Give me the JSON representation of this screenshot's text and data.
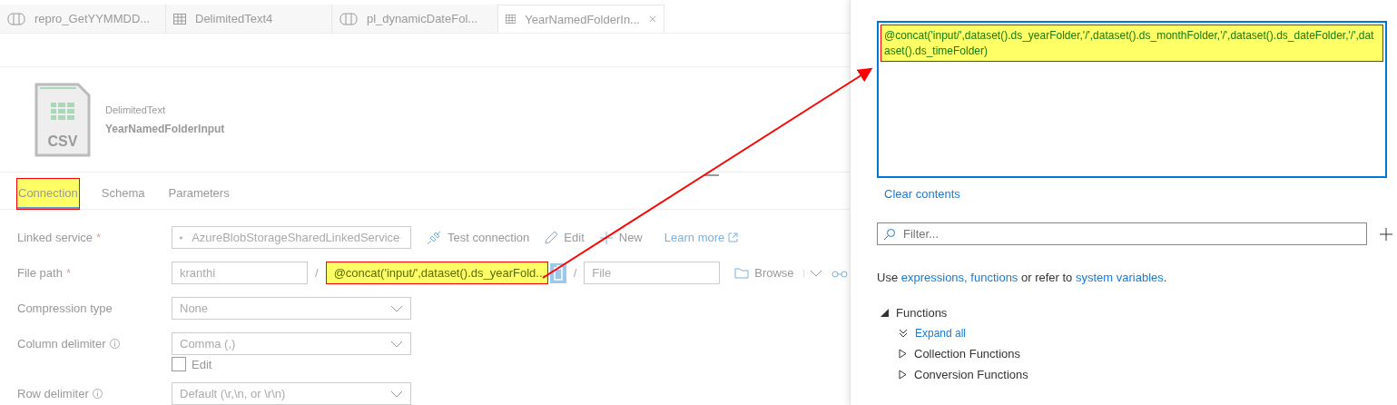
{
  "doc_tabs": [
    {
      "label": "repro_GetYYMMDD...",
      "kind": "pipeline",
      "selected": false
    },
    {
      "label": "DelimitedText4",
      "kind": "dataset",
      "selected": false
    },
    {
      "label": "pl_dynamicDateFol...",
      "kind": "pipeline",
      "selected": false
    },
    {
      "label": "YearNamedFolderIn...",
      "kind": "dataset",
      "selected": true
    }
  ],
  "dataset": {
    "type": "DelimitedText",
    "name": "YearNamedFolderInput",
    "icon_label": "CSV"
  },
  "section_tabs": [
    {
      "label": "Connection",
      "selected": true,
      "highlighted": true
    },
    {
      "label": "Schema",
      "selected": false,
      "highlighted": false
    },
    {
      "label": "Parameters",
      "selected": false,
      "highlighted": false
    }
  ],
  "linked_service": {
    "label": "Linked service",
    "required_mark": "*",
    "value": "AzureBlobStorageSharedLinkedService",
    "actions": [
      {
        "label": "Test connection",
        "kind": "plug"
      },
      {
        "label": "Edit",
        "kind": "pencil"
      },
      {
        "label": "New",
        "kind": "plus"
      },
      {
        "label": "Learn more",
        "kind": "link"
      }
    ]
  },
  "file_path": {
    "label": "File path",
    "required_mark": "*",
    "container": "kranthi",
    "separators": [
      "/",
      "/"
    ],
    "directory": "@concat('input/',dataset().ds_yearFold...",
    "directory_highlighted": true,
    "file_placeholder": "File",
    "browse": "Browse"
  },
  "compression": {
    "label": "Compression type",
    "value": "None"
  },
  "column_delimiter": {
    "label": "Column delimiter",
    "info": true,
    "value": "Comma (,)",
    "edit_label": "Edit",
    "edit_checked": false
  },
  "row_delimiter": {
    "label": "Row delimiter",
    "info": true,
    "value": "Default (\\r,\\n, or \\r\\n)"
  },
  "expression": {
    "value": "@concat('input/',dataset().ds_yearFolder,'/',dataset().ds_monthFolder,'/',dataset().ds_dateFolder,'/',dataset().ds_timeFolder)",
    "highlighted": true
  },
  "clear_contents": "Clear contents",
  "filter": {
    "placeholder": "Filter..."
  },
  "help": [
    {
      "kind": "text",
      "text": "Use "
    },
    {
      "kind": "link",
      "text": "expressions, functions"
    },
    {
      "kind": "text",
      "text": " or refer to "
    },
    {
      "kind": "link",
      "text": "system variables"
    },
    {
      "kind": "text",
      "text": "."
    }
  ],
  "functions": {
    "label": "Functions",
    "expanded": true,
    "expand_all": "Expand all",
    "children": [
      {
        "label": "Collection Functions",
        "expanded": false
      },
      {
        "label": "Conversion Functions",
        "expanded": false
      }
    ]
  }
}
